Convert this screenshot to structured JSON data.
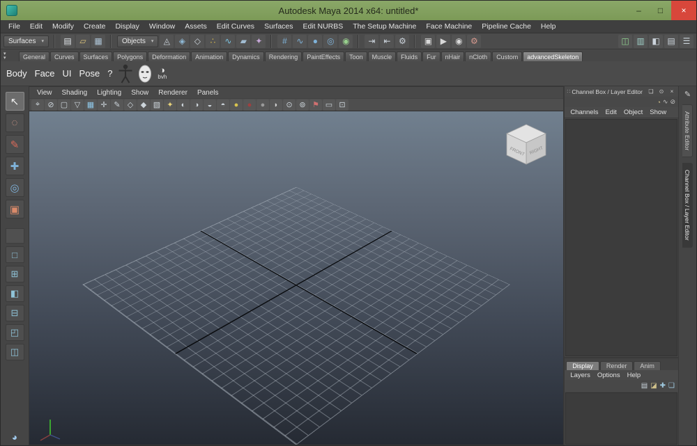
{
  "titlebar": {
    "title": "Autodesk Maya 2014 x64: untitled*",
    "minimize": "–",
    "maximize": "□",
    "close": "×"
  },
  "ui": {
    "caret": "▾",
    "shelf_arrow": "▾"
  },
  "menubar": {
    "items": [
      "File",
      "Edit",
      "Modify",
      "Create",
      "Display",
      "Window",
      "Assets",
      "Edit Curves",
      "Surfaces",
      "Edit NURBS",
      "The Setup Machine",
      "Face Machine",
      "Pipeline Cache",
      "Help"
    ]
  },
  "statusline": {
    "menu_set": "Surfaces",
    "selection_mask": "Objects",
    "file_icons": [
      {
        "name": "new-scene-icon",
        "glyph": "▤",
        "color": "#e0e4e8"
      },
      {
        "name": "open-scene-icon",
        "glyph": "▱",
        "color": "#d9c07a"
      },
      {
        "name": "save-scene-icon",
        "glyph": "▦",
        "color": "#aec4d6"
      }
    ],
    "selection_icons": [
      {
        "name": "select-hierarchy-icon",
        "glyph": "◬",
        "color": "#ccd4dc"
      },
      {
        "name": "select-object-icon",
        "glyph": "◈",
        "color": "#8fb9d6"
      },
      {
        "name": "select-component-icon",
        "glyph": "◇",
        "color": "#ccd4dc"
      },
      {
        "name": "select-points-icon",
        "glyph": "∴",
        "color": "#d6b84e"
      },
      {
        "name": "select-curves-icon",
        "glyph": "∿",
        "color": "#7cc4e2"
      },
      {
        "name": "select-surfaces-icon",
        "glyph": "▰",
        "color": "#a2bdd2"
      },
      {
        "name": "select-rendering-icon",
        "glyph": "✦",
        "color": "#c7a8d9"
      }
    ],
    "snap_icons": [
      {
        "name": "snap-to-grid-icon",
        "glyph": "#",
        "color": "#7fb2d9"
      },
      {
        "name": "snap-to-curve-icon",
        "glyph": "∿",
        "color": "#7fb2d9"
      },
      {
        "name": "snap-to-point-icon",
        "glyph": "●",
        "color": "#7fb2d9"
      },
      {
        "name": "snap-to-plane-icon",
        "glyph": "◎",
        "color": "#7fb2d9"
      },
      {
        "name": "make-live-icon",
        "glyph": "◉",
        "color": "#97cf8d"
      }
    ],
    "history_icons": [
      {
        "name": "input-connections-icon",
        "glyph": "⇥",
        "color": "#ccd4dc"
      },
      {
        "name": "output-connections-icon",
        "glyph": "⇤",
        "color": "#ccd4dc"
      },
      {
        "name": "construction-history-icon",
        "glyph": "⚙",
        "color": "#ccd4dc"
      }
    ],
    "render_icons": [
      {
        "name": "open-render-view-icon",
        "glyph": "▣",
        "color": "#d8d8d8"
      },
      {
        "name": "render-current-frame-icon",
        "glyph": "▶",
        "color": "#d8d8d8"
      },
      {
        "name": "ipr-render-icon",
        "glyph": "◉",
        "color": "#d8d8d8"
      },
      {
        "name": "render-settings-icon",
        "glyph": "⚙",
        "color": "#d89a8f"
      }
    ],
    "sidebar_icons": [
      {
        "name": "toggle-modeling-toolkit-icon",
        "glyph": "◫",
        "color": "#8fd08f"
      },
      {
        "name": "toggle-attribute-editor-icon",
        "glyph": "▥",
        "color": "#9fd0c8"
      },
      {
        "name": "toggle-tool-settings-icon",
        "glyph": "◧",
        "color": "#ccd4dc"
      },
      {
        "name": "toggle-channel-box-icon",
        "glyph": "▤",
        "color": "#ccd4dc"
      },
      {
        "name": "toggle-panel-menus-icon",
        "glyph": "☰",
        "color": "#ccd4dc"
      }
    ]
  },
  "shelf": {
    "tabs": [
      {
        "label": "General"
      },
      {
        "label": "Curves"
      },
      {
        "label": "Surfaces"
      },
      {
        "label": "Polygons"
      },
      {
        "label": "Deformation"
      },
      {
        "label": "Animation"
      },
      {
        "label": "Dynamics"
      },
      {
        "label": "Rendering"
      },
      {
        "label": "PaintEffects"
      },
      {
        "label": "Toon"
      },
      {
        "label": "Muscle"
      },
      {
        "label": "Fluids"
      },
      {
        "label": "Fur"
      },
      {
        "label": "nHair"
      },
      {
        "label": "nCloth"
      },
      {
        "label": "Custom"
      },
      {
        "label": "advancedSkeleton",
        "active": true
      }
    ],
    "items": [
      {
        "label": "Body",
        "name": "body"
      },
      {
        "label": "Face",
        "name": "face"
      },
      {
        "label": "UI",
        "name": "ui"
      },
      {
        "label": "Pose",
        "name": "pose"
      },
      {
        "label": "?",
        "name": "help"
      }
    ],
    "bvh_glyph": "◑",
    "bvh_label": "bvh"
  },
  "panel_menu": {
    "items": [
      "View",
      "Shading",
      "Lighting",
      "Show",
      "Renderer",
      "Panels"
    ]
  },
  "viewport": {
    "toolbar_icons": [
      {
        "name": "select-camera-icon",
        "glyph": "⌖",
        "color": "#ccd4da"
      },
      {
        "name": "lock-camera-icon",
        "glyph": "⊘",
        "color": "#ccd4da"
      },
      {
        "name": "camera-attributes-icon",
        "glyph": "▢",
        "color": "#ccd4da"
      },
      {
        "name": "bookmarks-icon",
        "glyph": "▽",
        "color": "#ccd4da"
      },
      {
        "name": "image-plane-icon",
        "glyph": "▦",
        "color": "#8fc7e8"
      },
      {
        "name": "two-d-pan-zoom-icon",
        "glyph": "✛",
        "color": "#ccd4da"
      },
      {
        "name": "grease-pencil-icon",
        "glyph": "✎",
        "color": "#ccd4da"
      },
      {
        "name": "wireframe-mode-icon",
        "glyph": "◇",
        "color": "#ccd4da"
      },
      {
        "name": "shaded-mode-icon",
        "glyph": "◆",
        "color": "#ccd4da"
      },
      {
        "name": "textured-mode-icon",
        "glyph": "▧",
        "color": "#ccd4da"
      },
      {
        "name": "use-all-lights-icon",
        "glyph": "✦",
        "color": "#e8d27a"
      },
      {
        "name": "shadows-icon",
        "glyph": "◐",
        "color": "#ccd4da"
      },
      {
        "name": "screen-space-ao-icon",
        "glyph": "◑",
        "color": "#ccd4da"
      },
      {
        "name": "motion-blur-icon",
        "glyph": "◒",
        "color": "#ccd4da"
      },
      {
        "name": "multisample-icon",
        "glyph": "◓",
        "color": "#ccd4da"
      },
      {
        "name": "default-material-ball-icon",
        "glyph": "●",
        "color": "#d8c44e"
      },
      {
        "name": "color-managed-ball-icon",
        "glyph": "●",
        "color": "#a04040"
      },
      {
        "name": "gamma-ball-icon",
        "glyph": "●",
        "color": "#9a9a9a"
      },
      {
        "name": "exposure-icon",
        "glyph": "◗",
        "color": "#cfcfcf"
      },
      {
        "name": "isolate-select-icon",
        "glyph": "⊙",
        "color": "#ccd4da"
      },
      {
        "name": "xray-icon",
        "glyph": "⊚",
        "color": "#ccd4da"
      },
      {
        "name": "joints-xray-icon",
        "glyph": "⚑",
        "color": "#d07070"
      },
      {
        "name": "resolution-gate-icon",
        "glyph": "▭",
        "color": "#ccd4da"
      },
      {
        "name": "field-chart-icon",
        "glyph": "⊡",
        "color": "#ccd4da"
      }
    ],
    "viewcube": {
      "front": "FRONT",
      "right": "RIGHT"
    }
  },
  "toolbox": {
    "tools": [
      {
        "name": "select-tool-icon",
        "glyph": "↖",
        "color": "#f0f0f0",
        "active": true
      },
      {
        "name": "lasso-tool-icon",
        "glyph": "◌",
        "color": "#e0a090"
      },
      {
        "name": "paint-select-tool-icon",
        "glyph": "✎",
        "color": "#d96a5a"
      },
      {
        "name": "move-tool-icon",
        "glyph": "✚",
        "color": "#7fb2d9"
      },
      {
        "name": "rotate-tool-icon",
        "glyph": "◎",
        "color": "#7fb2d9"
      },
      {
        "name": "scale-tool-icon",
        "glyph": "▣",
        "color": "#d98a6a"
      }
    ],
    "layouts": [
      {
        "name": "single-pane-layout-icon",
        "glyph": "□"
      },
      {
        "name": "four-pane-layout-icon",
        "glyph": "⊞"
      },
      {
        "name": "persp-outliner-layout-icon",
        "glyph": "◧"
      },
      {
        "name": "persp-graph-layout-icon",
        "glyph": "⊟"
      },
      {
        "name": "hypershade-persp-layout-icon",
        "glyph": "◰"
      },
      {
        "name": "persp-uv-layout-icon",
        "glyph": "◫"
      }
    ],
    "bottom_icon": {
      "glyph": "◕"
    }
  },
  "channel_box": {
    "title": "Channel Box / Layer Editor",
    "grip": "∷",
    "header_icons": [
      {
        "name": "copy-tab-icon",
        "glyph": "❏"
      },
      {
        "name": "pin-icon",
        "glyph": "⊙"
      },
      {
        "name": "close-icon",
        "glyph": "×"
      }
    ],
    "toolbar_icons": [
      {
        "name": "display-speed-icon",
        "glyph": "◔",
        "color": "#cfc08a"
      },
      {
        "name": "channel-graph-icon",
        "glyph": "∿",
        "color": "#c8c8c8"
      },
      {
        "name": "lock-icon",
        "glyph": "⊘",
        "color": "#c8c8c8"
      }
    ],
    "menus": [
      "Channels",
      "Edit",
      "Object",
      "Show"
    ],
    "layer_tabs": [
      {
        "label": "Display",
        "active": true
      },
      {
        "label": "Render"
      },
      {
        "label": "Anim"
      }
    ],
    "layer_menus": [
      "Layers",
      "Options",
      "Help"
    ],
    "layer_icons": [
      {
        "name": "layer-list-icon",
        "glyph": "▤",
        "color": "#c8d2da"
      },
      {
        "name": "layer-sort-icon",
        "glyph": "◪",
        "color": "#cfc08a"
      },
      {
        "name": "new-empty-layer-icon",
        "glyph": "✚",
        "color": "#9fc9df"
      },
      {
        "name": "new-layer-from-selected-icon",
        "glyph": "❏",
        "color": "#9fc9df"
      }
    ]
  },
  "side_strip": {
    "pencil": "✎"
  },
  "side_tabs": [
    {
      "label": "Attribute Editor",
      "name": "attribute-editor"
    },
    {
      "label": "Channel Box / Layer Editor",
      "name": "channel-box-layer-editor",
      "active": true
    }
  ],
  "colors": {
    "titlebar_green": "#7c9a57",
    "close_red": "#d8473b",
    "viewport_top": "#71808f",
    "viewport_bottom": "#252a33",
    "panel_bg": "#454545"
  }
}
